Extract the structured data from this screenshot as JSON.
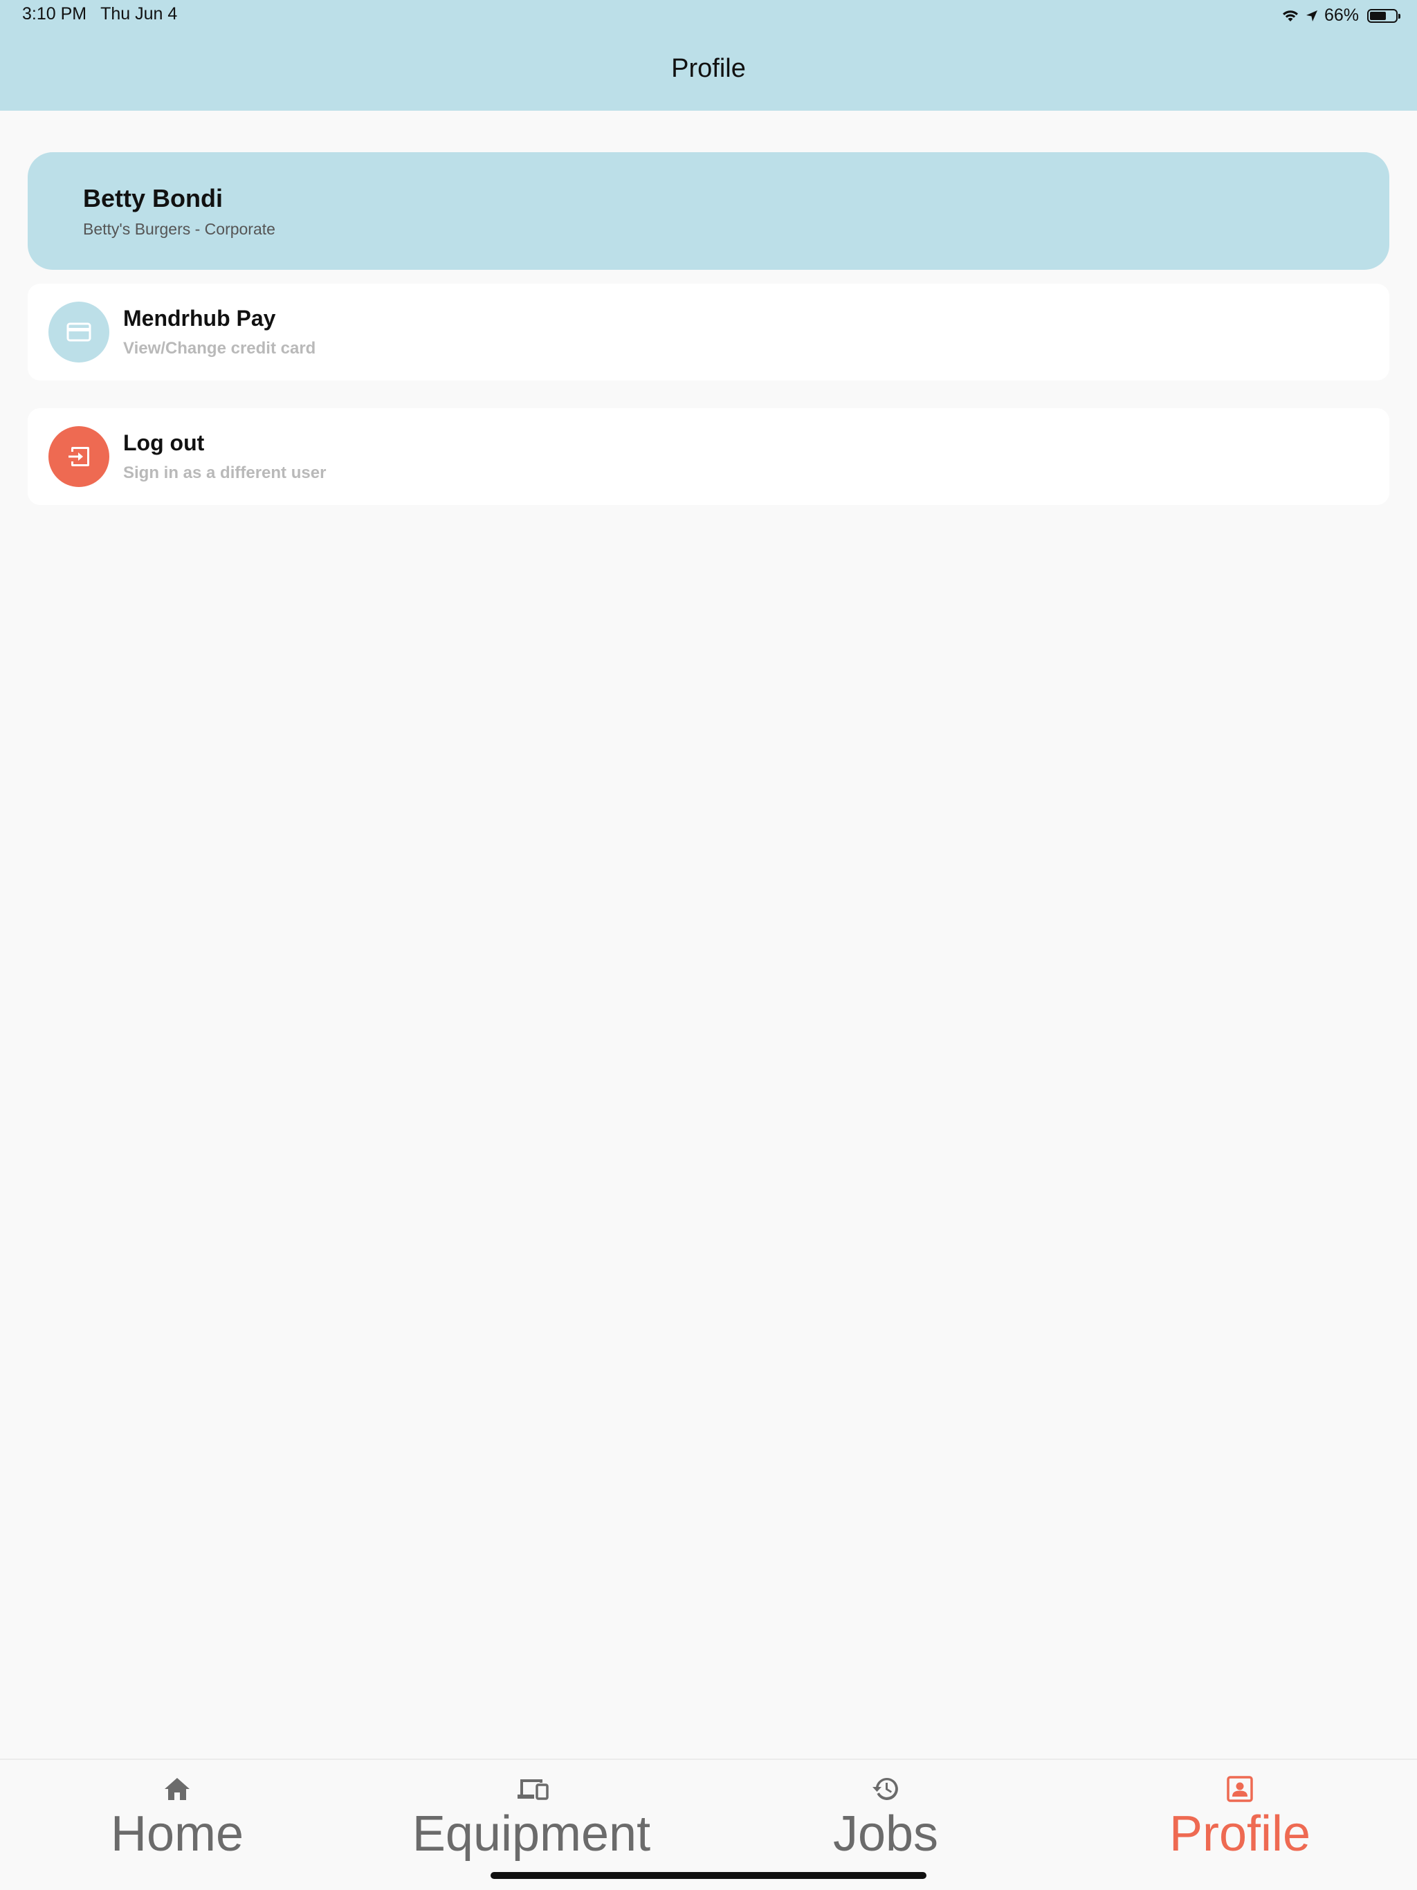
{
  "status_bar": {
    "time": "3:10 PM",
    "date": "Thu Jun 4",
    "battery": "66%",
    "battery_level": 0.66
  },
  "header": {
    "title": "Profile"
  },
  "profile": {
    "name": "Betty Bondi",
    "organization": "Betty's Burgers - Corporate"
  },
  "actions": [
    {
      "title": "Mendrhub Pay",
      "subtitle": "View/Change credit card",
      "icon": "credit-card-icon",
      "color": "#bcdfe8"
    },
    {
      "title": "Log out",
      "subtitle": "Sign in as a different user",
      "icon": "logout-icon",
      "color": "#ee6a52"
    }
  ],
  "tabs": [
    {
      "label": "Home",
      "icon": "home-icon",
      "active": false
    },
    {
      "label": "Equipment",
      "icon": "devices-icon",
      "active": false
    },
    {
      "label": "Jobs",
      "icon": "history-icon",
      "active": false
    },
    {
      "label": "Profile",
      "icon": "profile-icon",
      "active": true
    }
  ],
  "colors": {
    "header_bg": "#bcdfe8",
    "accent": "#ee6a52",
    "tab_inactive": "#6b6b6b"
  }
}
